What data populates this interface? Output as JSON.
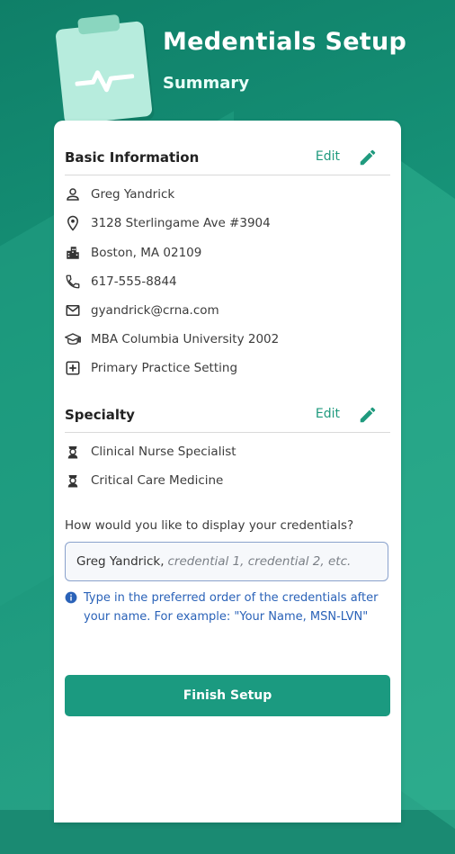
{
  "header": {
    "title": "Medentials Setup",
    "subtitle": "Summary"
  },
  "basic_info": {
    "title": "Basic Information",
    "edit_label": "Edit",
    "items": [
      {
        "icon": "person-icon",
        "text": "Greg Yandrick"
      },
      {
        "icon": "location-pin-icon",
        "text": "3128 Sterlingame Ave #3904"
      },
      {
        "icon": "city-icon",
        "text": "Boston, MA 02109"
      },
      {
        "icon": "phone-icon",
        "text": "617-555-8844"
      },
      {
        "icon": "mail-icon",
        "text": "gyandrick@crna.com"
      },
      {
        "icon": "graduation-cap-icon",
        "text": "MBA Columbia University 2002"
      },
      {
        "icon": "medical-plus-icon",
        "text": "Primary Practice Setting"
      }
    ]
  },
  "specialty": {
    "title": "Specialty",
    "edit_label": "Edit",
    "items": [
      {
        "icon": "nurse-icon",
        "text": "Clinical Nurse Specialist"
      },
      {
        "icon": "nurse-icon",
        "text": "Critical Care Medicine"
      }
    ]
  },
  "credentials": {
    "question": "How would you like to display your credentials?",
    "input_name": "Greg Yandrick,",
    "input_placeholder": "credential 1, credential 2, etc.",
    "hint": "Type in the preferred order of the credentials after your name.  For example: \"Your Name, MSN-LVN\""
  },
  "finish_label": "Finish Setup",
  "colors": {
    "accent": "#1b9a80",
    "hint": "#2a62b8",
    "background": "#179479"
  }
}
